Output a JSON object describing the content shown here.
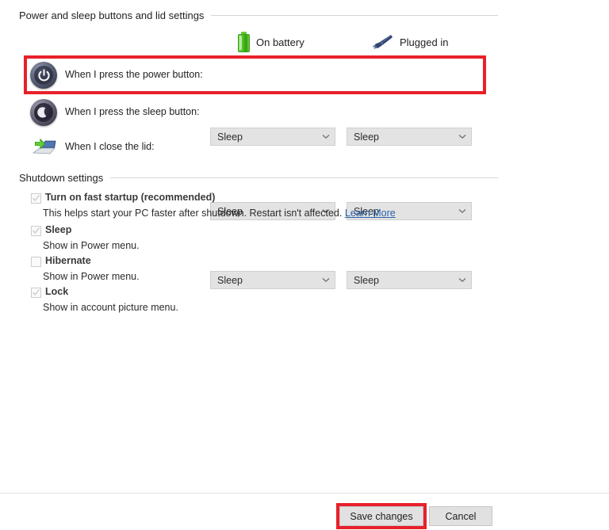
{
  "sections": {
    "power_buttons": {
      "title": "Power and sleep buttons and lid settings"
    },
    "shutdown": {
      "title": "Shutdown settings"
    }
  },
  "columns": [
    {
      "label": "On battery",
      "icon": "battery-icon"
    },
    {
      "label": "Plugged in",
      "icon": "power-plug-icon"
    }
  ],
  "settings_rows": [
    {
      "icon": "power-button-icon",
      "label": "When I press the power button:",
      "on_battery": "Sleep",
      "plugged_in": "Sleep"
    },
    {
      "icon": "sleep-moon-icon",
      "label": "When I press the sleep button:",
      "on_battery": "Sleep",
      "plugged_in": "Sleep"
    },
    {
      "icon": "laptop-lid-icon",
      "label": "When I close the lid:",
      "on_battery": "Sleep",
      "plugged_in": "Sleep"
    }
  ],
  "shutdown_options": [
    {
      "label": "Turn on fast startup (recommended)",
      "checked": true,
      "disabled": true,
      "description": "This helps start your PC faster after shutdown. Restart isn't affected.",
      "link": "Learn More"
    },
    {
      "label": "Sleep",
      "checked": true,
      "disabled": true,
      "description": "Show in Power menu.",
      "link": ""
    },
    {
      "label": "Hibernate",
      "checked": false,
      "disabled": true,
      "description": "Show in Power menu.",
      "link": ""
    },
    {
      "label": "Lock",
      "checked": true,
      "disabled": true,
      "description": "Show in account picture menu.",
      "link": ""
    }
  ],
  "footer": {
    "save_label": "Save changes",
    "cancel_label": "Cancel"
  },
  "annotations": {
    "color": "#e8202a",
    "targets": [
      "power-button-row",
      "save-changes-button"
    ]
  }
}
